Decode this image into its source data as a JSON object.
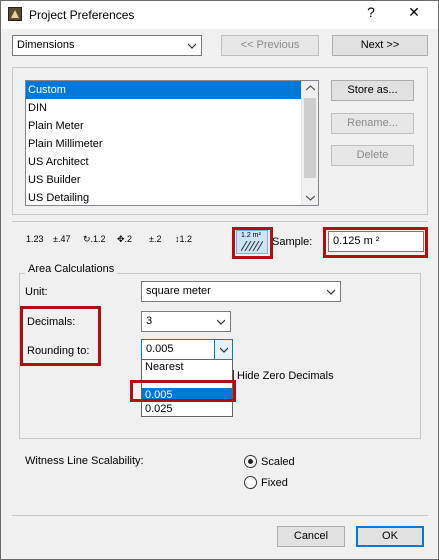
{
  "window": {
    "title": "Project Preferences",
    "help_glyph": "?",
    "close_glyph": "✕"
  },
  "header": {
    "category_select": "Dimensions",
    "previous_label": "<< Previous",
    "next_label": "Next >>"
  },
  "presets": {
    "items": [
      "Custom",
      "DIN",
      "Plain Meter",
      "Plain Millimeter",
      "US Architect",
      "US Builder",
      "US Detailing"
    ],
    "selected_index": 0,
    "store_as_label": "Store as...",
    "rename_label": "Rename...",
    "delete_label": "Delete"
  },
  "dimension_tools": {
    "tool_labels": [
      "1.23",
      "±.47",
      "↻.1.2",
      "✥.2",
      "±.2",
      "↕1.2",
      "1.2 m²"
    ],
    "selected_tool": "area-dimension",
    "sample_label": "Sample:",
    "sample_value": "0.125 m ²"
  },
  "area": {
    "group_title": "Area Calculations",
    "unit_label": "Unit:",
    "unit_value": "square meter",
    "decimals_label": "Decimals:",
    "decimals_value": "3",
    "rounding_label": "Rounding to:",
    "rounding_value": "0.005",
    "rounding_options": [
      "Nearest",
      "",
      "0.005",
      "0.025"
    ],
    "rounding_selected_index": 2,
    "hide_zero_label": "Hide Zero Decimals"
  },
  "witness": {
    "label": "Witness Line Scalability:",
    "options": [
      "Scaled",
      "Fixed"
    ],
    "selected": "Scaled"
  },
  "footer": {
    "cancel_label": "Cancel",
    "ok_label": "OK"
  },
  "colors": {
    "highlight": "#b10f14",
    "selection": "#0078d7"
  }
}
